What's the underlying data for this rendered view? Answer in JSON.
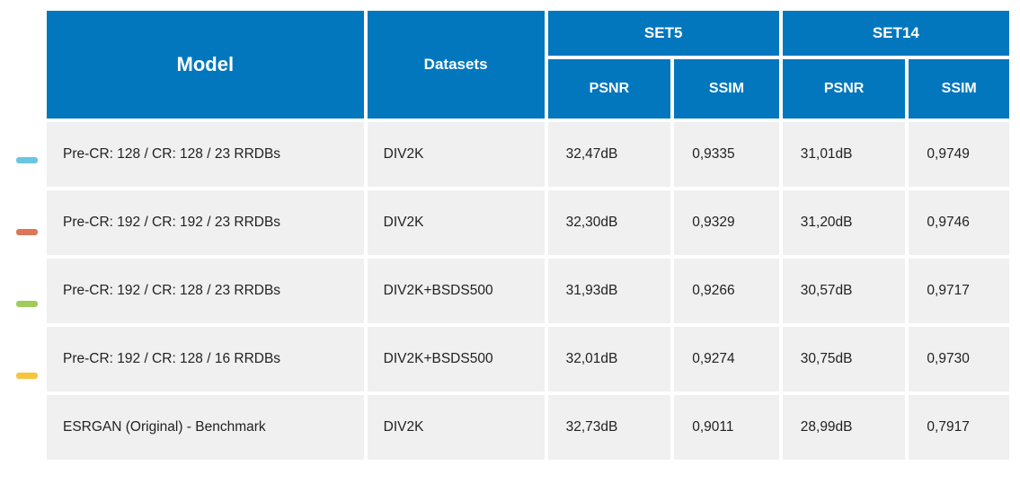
{
  "headers": {
    "model": "Model",
    "datasets": "Datasets",
    "set5": "SET5",
    "set14": "SET14",
    "psnr": "PSNR",
    "ssim": "SSIM"
  },
  "rows": [
    {
      "marker_color": "#6AC6E0",
      "model": "Pre-CR: 128 / CR: 128 / 23 RRDBs",
      "datasets": "DIV2K",
      "set5_psnr": "32,47dB",
      "set5_ssim": "0,9335",
      "set14_psnr": "31,01dB",
      "set14_ssim": "0,9749"
    },
    {
      "marker_color": "#D97757",
      "model": "Pre-CR: 192 / CR: 192 / 23 RRDBs",
      "datasets": "DIV2K",
      "set5_psnr": "32,30dB",
      "set5_ssim": "0,9329",
      "set14_psnr": "31,20dB",
      "set14_ssim": "0,9746"
    },
    {
      "marker_color": "#9ECC5A",
      "model": "Pre-CR: 192 / CR: 128 / 23 RRDBs",
      "datasets": "DIV2K+BSDS500",
      "set5_psnr": "31,93dB",
      "set5_ssim": "0,9266",
      "set14_psnr": "30,57dB",
      "set14_ssim": "0,9717"
    },
    {
      "marker_color": "#F7C43C",
      "model": "Pre-CR: 192 / CR: 128 / 16 RRDBs",
      "datasets": "DIV2K+BSDS500",
      "set5_psnr": "32,01dB",
      "set5_ssim": "0,9274",
      "set14_psnr": "30,75dB",
      "set14_ssim": "0,9730"
    },
    {
      "marker_color": "",
      "model": "ESRGAN (Original) - Benchmark",
      "datasets": "DIV2K",
      "set5_psnr": "32,73dB",
      "set5_ssim": "0,9011",
      "set14_psnr": "28,99dB",
      "set14_ssim": "0,7917"
    }
  ]
}
